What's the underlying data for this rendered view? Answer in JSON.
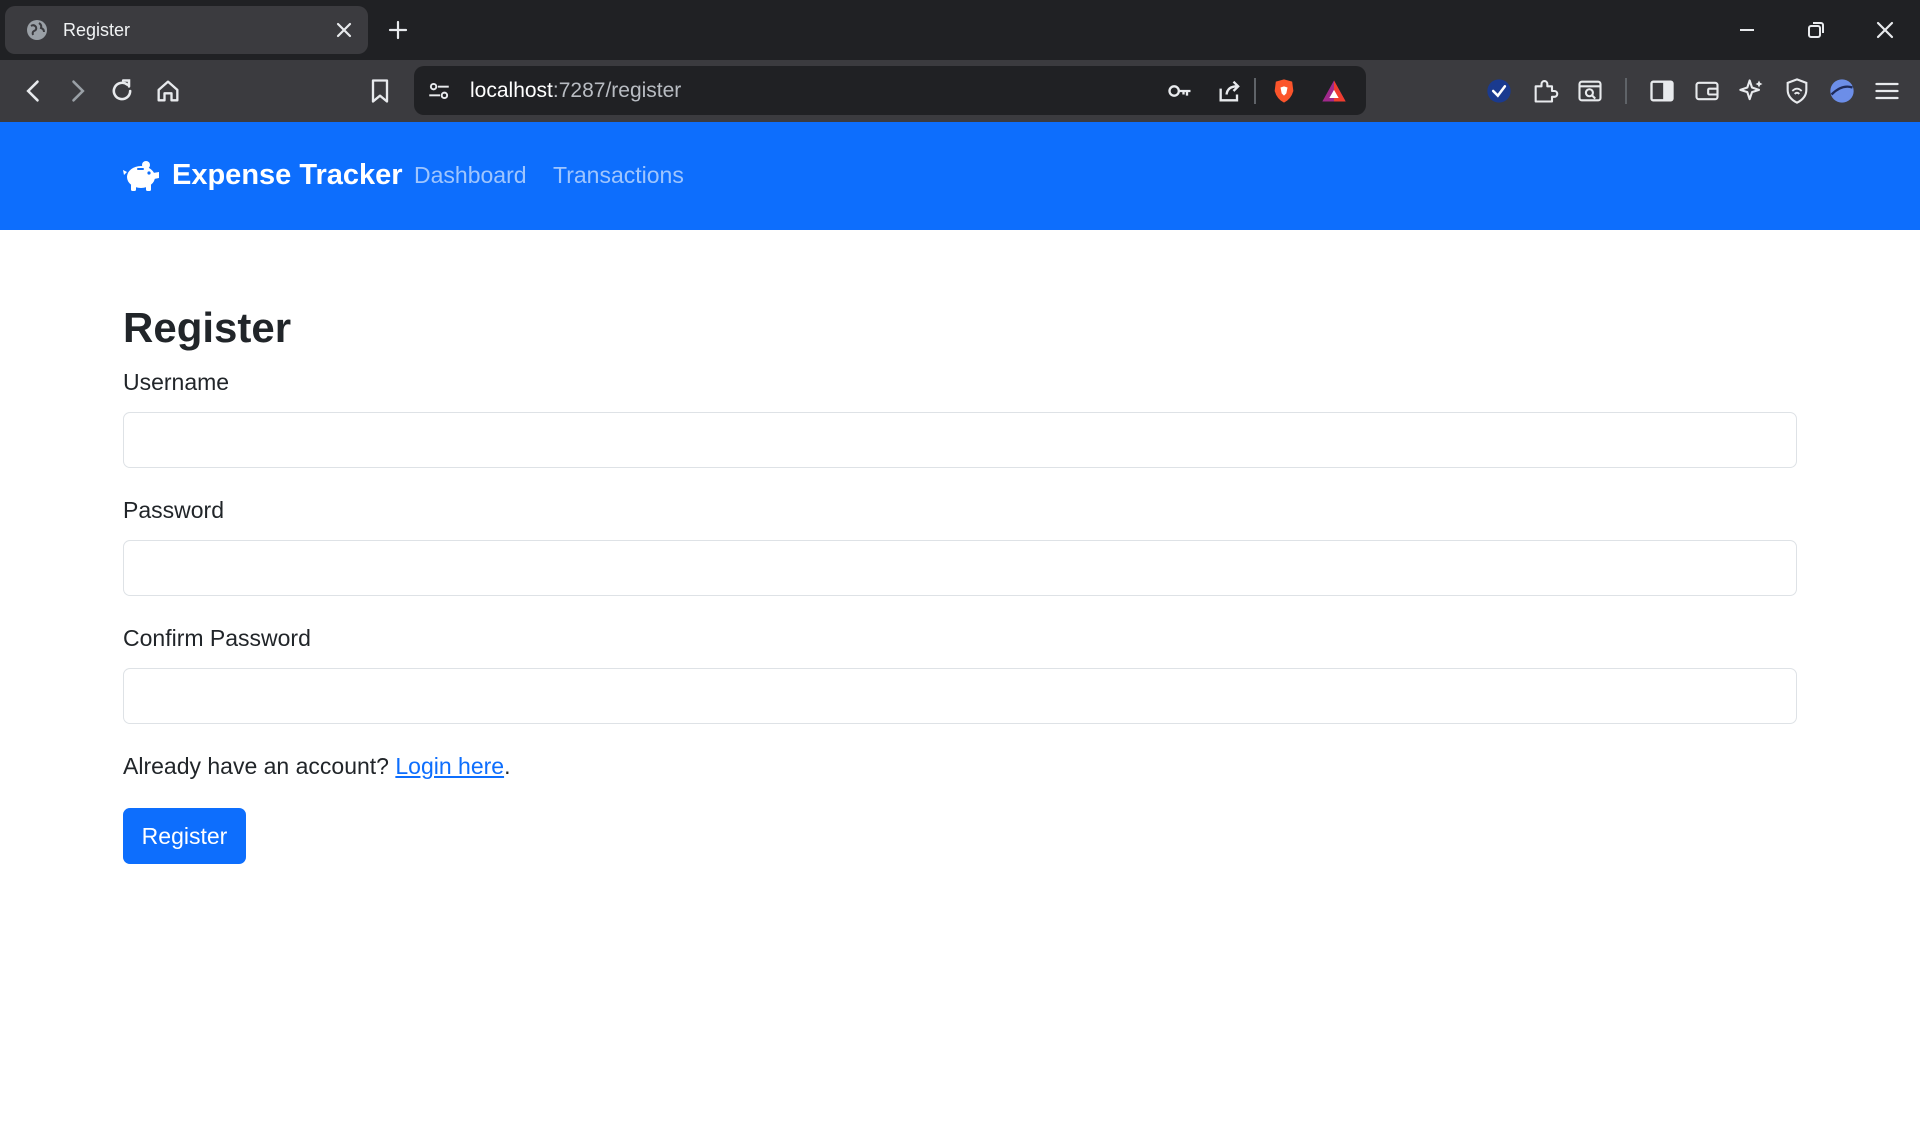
{
  "browser": {
    "tab_title": "Register",
    "url_host": "localhost",
    "url_rest": ":7287/register",
    "icons": [
      "globe-icon",
      "close-icon",
      "plus-icon",
      "minimize-icon",
      "restore-icon",
      "close-window-icon",
      "back-icon",
      "forward-icon",
      "reload-icon",
      "home-icon",
      "bookmark-icon",
      "site-settings-icon",
      "key-icon",
      "share-icon",
      "brave-shields-icon",
      "brave-rewards-icon",
      "vpn-check-icon",
      "extensions-icon",
      "page-search-icon",
      "sidebar-icon",
      "wallet-icon",
      "leo-ai-icon",
      "shield-icon",
      "profile-icon",
      "menu-icon"
    ]
  },
  "navbar": {
    "brand": "Expense Tracker",
    "links": [
      "Dashboard",
      "Transactions"
    ],
    "colors": {
      "background": "#0d6efd"
    }
  },
  "form": {
    "title": "Register",
    "username_label": "Username",
    "password_label": "Password",
    "confirm_label": "Confirm Password",
    "username_value": "",
    "password_value": "",
    "confirm_value": "",
    "help_text": "Already have an account?",
    "login_link": "Login here",
    "help_suffix": ".",
    "submit_label": "Register"
  }
}
